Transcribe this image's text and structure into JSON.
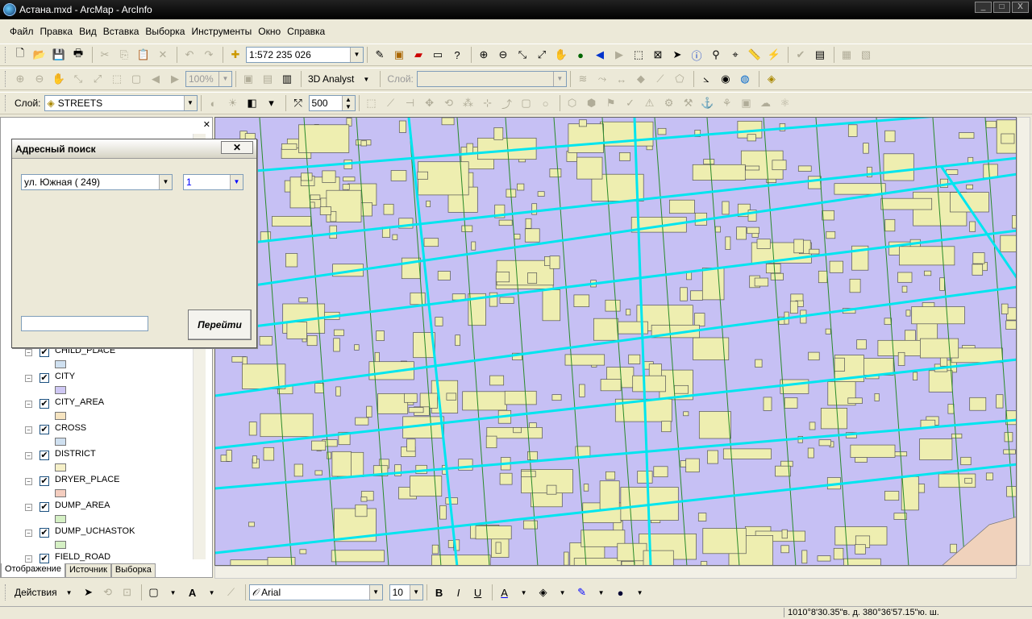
{
  "window": {
    "title": "Астана.mxd - ArcMap - ArcInfo",
    "minimize": "_",
    "maximize": "□",
    "close": "X"
  },
  "menu": [
    "Файл",
    "Правка",
    "Вид",
    "Вставка",
    "Выборка",
    "Инструменты",
    "Окно",
    "Справка"
  ],
  "toolbar1": {
    "scale": "1:572 235 026"
  },
  "toolbar2": {
    "zoom": "100%",
    "analyst": "3D Analyst",
    "layer_label": "Слой:"
  },
  "toolbar3": {
    "layer_label": "Слой:",
    "layer_value": "STREETS",
    "distance": "500"
  },
  "toc": {
    "layers": [
      {
        "name": "CHILD_PLACE",
        "color": "#cfe0f0"
      },
      {
        "name": "CITY",
        "color": "#cfe0f0"
      },
      {
        "name": "CITY_AREA",
        "color": "#cfc8f4"
      },
      {
        "name": "CROSS",
        "color": "#f6e4c0"
      },
      {
        "name": "DISTRICT",
        "color": "#cfe0f0"
      },
      {
        "name": "DRYER_PLACE",
        "color": "#f6f0c8"
      },
      {
        "name": "DUMP_AREA",
        "color": "#f4cdbf"
      },
      {
        "name": "DUMP_UCHASTOK",
        "color": "#d5f0c4"
      },
      {
        "name": "FIELD_ROAD",
        "color": "#d5f0c4"
      }
    ],
    "tabs": [
      "Отображение",
      "Источник",
      "Выборка"
    ]
  },
  "dialog": {
    "title": "Адресный поиск",
    "street": "ул. Южная ( 249)",
    "house": "1",
    "go_button": "Перейти"
  },
  "drawing": {
    "actions": "Действия",
    "font": "Arial",
    "size": "10",
    "bold": "B",
    "italic": "I",
    "underline": "U",
    "text_tool": "A"
  },
  "status": {
    "coords": "1010°8'30.35\"в. д.  380°36'57.15\"ю. ш."
  },
  "colors": {
    "map_bg": "#c6c0f4",
    "building": "#eeeeb0",
    "street": "#00e5ef",
    "parcel": "#2a8a2a"
  }
}
